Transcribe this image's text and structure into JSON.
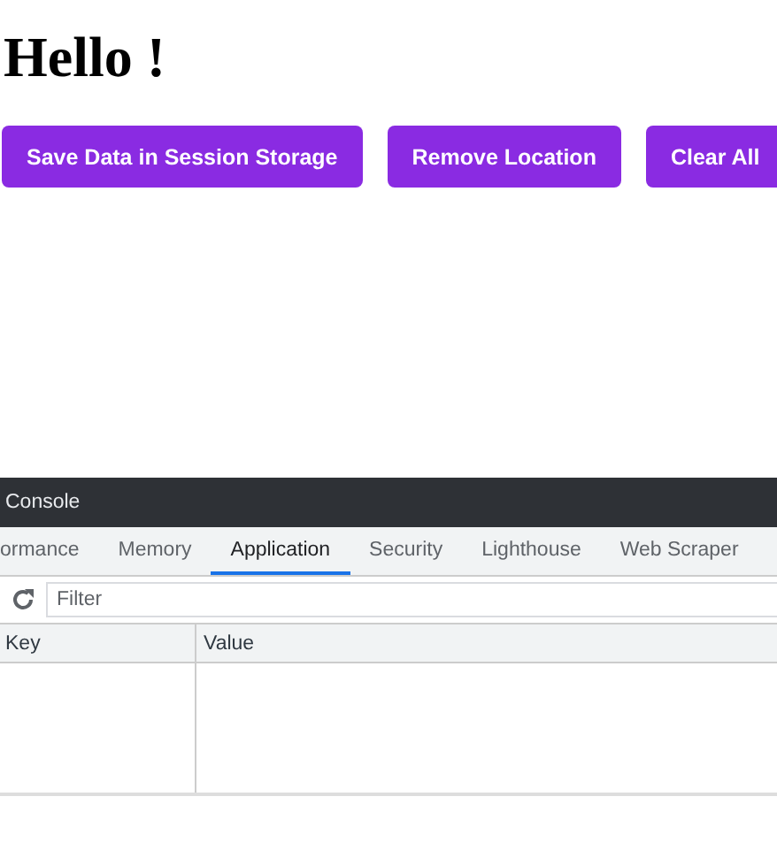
{
  "heading": "Hello !",
  "buttons": [
    "Save Data in Session Storage",
    "Remove Location",
    "Clear All"
  ],
  "devtools": {
    "drawer_tab": "Console",
    "tabs": [
      {
        "label": "ormance",
        "selected": false
      },
      {
        "label": "Memory",
        "selected": false
      },
      {
        "label": "Application",
        "selected": true
      },
      {
        "label": "Security",
        "selected": false
      },
      {
        "label": "Lighthouse",
        "selected": false
      },
      {
        "label": "Web Scraper",
        "selected": false
      }
    ],
    "filter": {
      "placeholder": "Filter"
    },
    "table": {
      "columns": [
        "Key",
        "Value"
      ]
    }
  }
}
